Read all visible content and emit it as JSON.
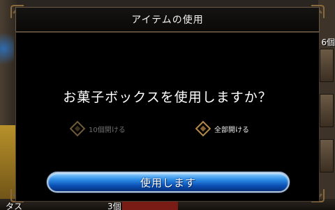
{
  "dialog": {
    "title": "アイテムの使用",
    "question": "お菓子ボックスを使用しますか？",
    "options": [
      {
        "label": "10個開ける",
        "enabled": false
      },
      {
        "label": "全部開ける",
        "enabled": true
      }
    ],
    "confirm_label": "使用します"
  },
  "background": {
    "right_text": "6個",
    "bottom_left_text": "タス",
    "bottom_mid_text": "3個"
  },
  "colors": {
    "button_blue": "#0a4fb5",
    "panel": "#000000",
    "frame_gold": "#8a6a3c"
  }
}
